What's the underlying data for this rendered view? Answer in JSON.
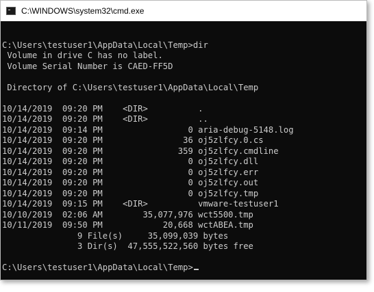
{
  "window": {
    "title": "C:\\WINDOWS\\system32\\cmd.exe",
    "icon": "cmd-console-icon"
  },
  "console": {
    "lines": [
      "",
      "C:\\Users\\testuser1\\AppData\\Local\\Temp>dir",
      " Volume in drive C has no label.",
      " Volume Serial Number is CAED-FF5D",
      "",
      " Directory of C:\\Users\\testuser1\\AppData\\Local\\Temp",
      "",
      "10/14/2019  09:20 PM    <DIR>          .",
      "10/14/2019  09:20 PM    <DIR>          ..",
      "10/14/2019  09:14 PM                 0 aria-debug-5148.log",
      "10/14/2019  09:20 PM                36 oj5zlfcy.0.cs",
      "10/14/2019  09:20 PM               359 oj5zlfcy.cmdline",
      "10/14/2019  09:20 PM                 0 oj5zlfcy.dll",
      "10/14/2019  09:20 PM                 0 oj5zlfcy.err",
      "10/14/2019  09:20 PM                 0 oj5zlfcy.out",
      "10/14/2019  09:20 PM                 0 oj5zlfcy.tmp",
      "10/14/2019  09:15 PM    <DIR>          vmware-testuser1",
      "10/10/2019  02:06 AM        35,077,976 wct5500.tmp",
      "10/11/2019  09:50 PM            20,668 wctABEA.tmp",
      "               9 File(s)     35,099,039 bytes",
      "               3 Dir(s)  47,555,522,560 bytes free",
      ""
    ],
    "prompt": "C:\\Users\\testuser1\\AppData\\Local\\Temp>"
  }
}
